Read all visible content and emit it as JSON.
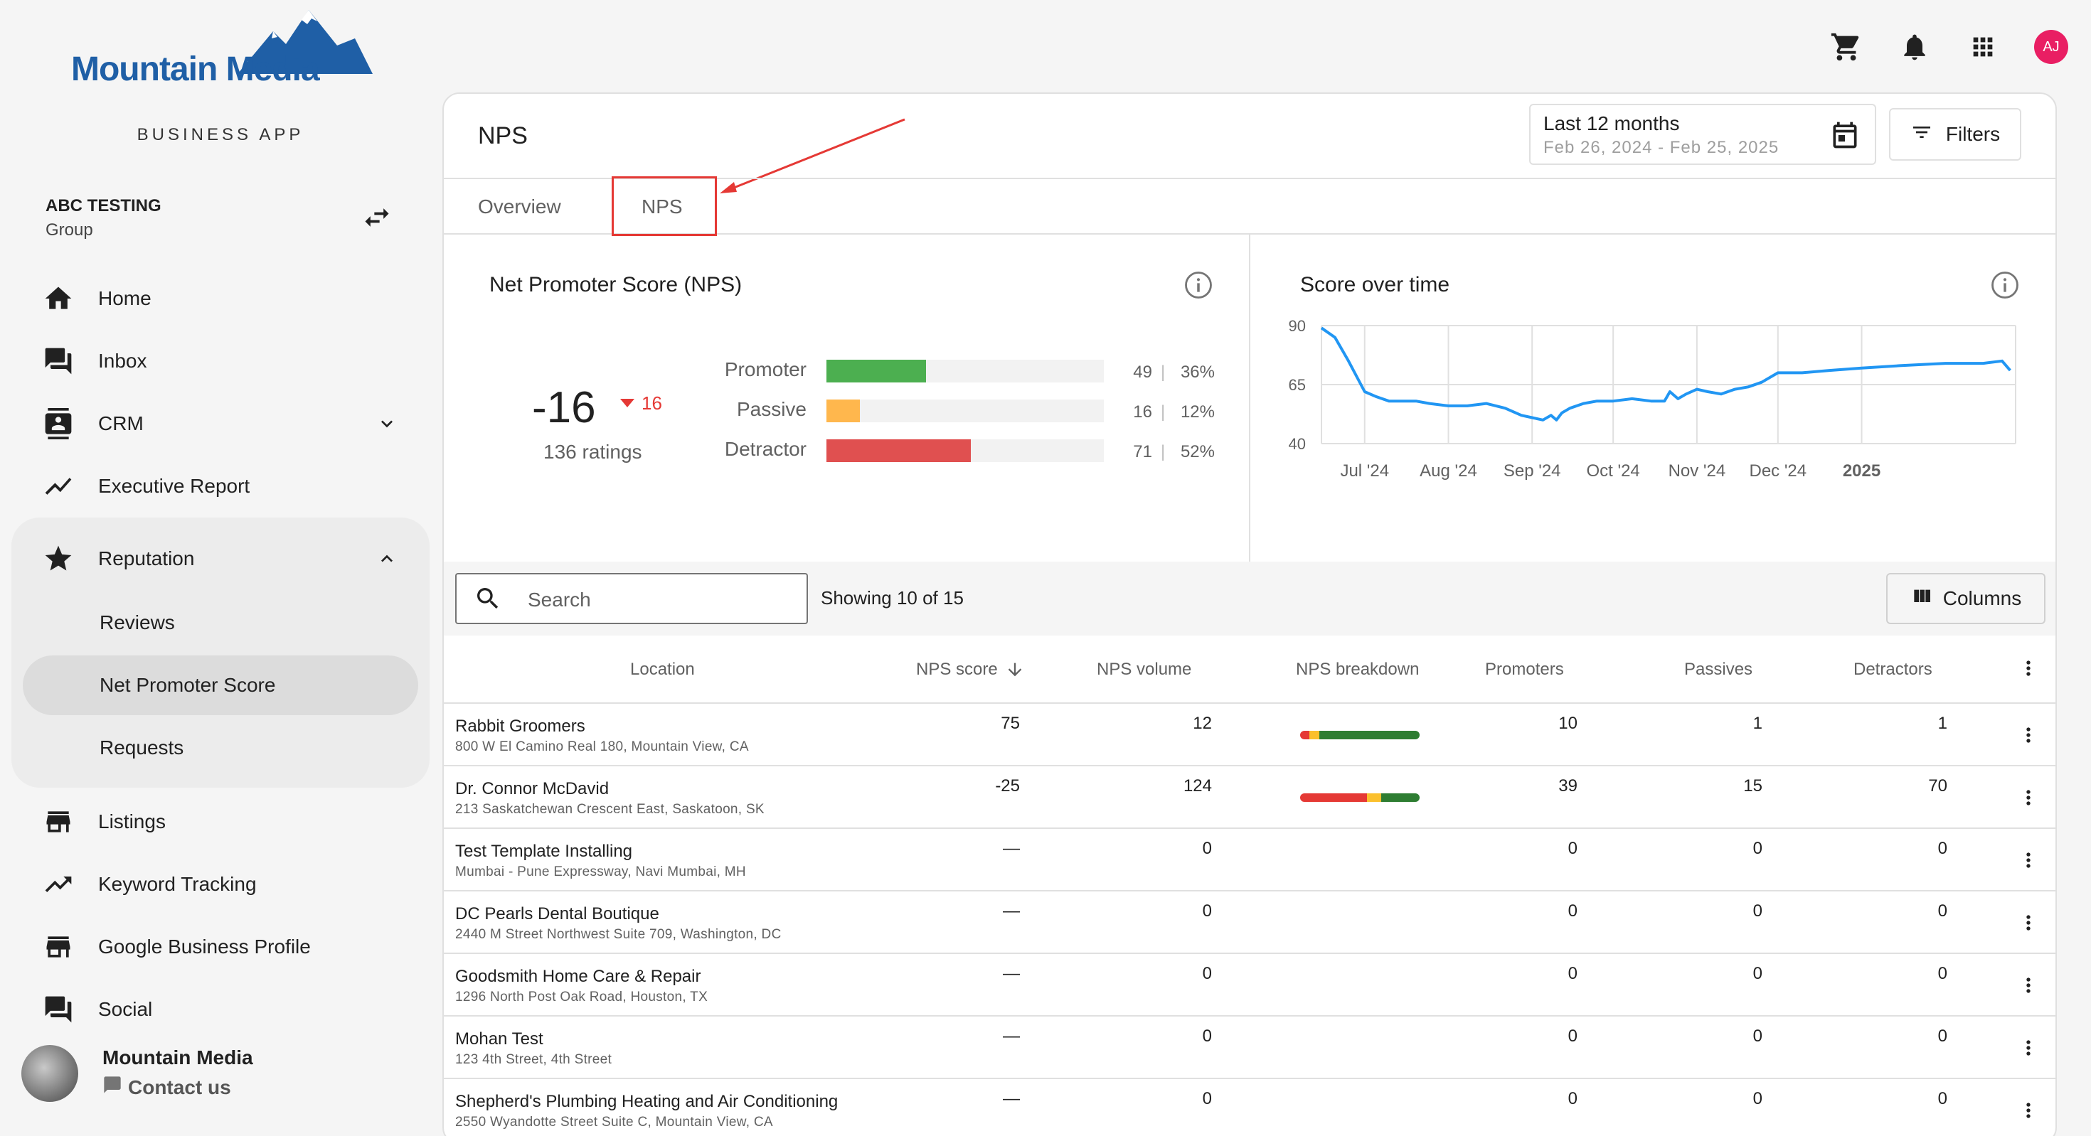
{
  "brand": {
    "logo_text": "Mountain Media",
    "subtitle": "BUSINESS APP",
    "color": "#1f5fa6"
  },
  "account": {
    "name": "ABC TESTING",
    "type": "Group"
  },
  "nav": {
    "home": "Home",
    "inbox": "Inbox",
    "crm": "CRM",
    "executive_report": "Executive Report",
    "reputation": "Reputation",
    "reviews": "Reviews",
    "net_promoter_score": "Net Promoter Score",
    "requests": "Requests",
    "listings": "Listings",
    "keyword_tracking": "Keyword Tracking",
    "google_business_profile": "Google Business Profile",
    "social": "Social"
  },
  "footer": {
    "name": "Mountain Media",
    "contact": "Contact us"
  },
  "topbar": {
    "user_initials": "AJ",
    "avatar_color": "#e91e63"
  },
  "page": {
    "title": "NPS",
    "date_range": {
      "label": "Last 12 months",
      "range": "Feb 26, 2024 - Feb 25, 2025"
    },
    "filters_label": "Filters",
    "tabs": [
      "Overview",
      "NPS"
    ],
    "active_tab": "NPS"
  },
  "nps_panel": {
    "title": "Net Promoter Score (NPS)",
    "score": "-16",
    "delta": "16",
    "ratings": "136 ratings",
    "rows": [
      {
        "label": "Promoter",
        "count": "49",
        "pct": "36%",
        "fraction": 0.36,
        "color": "#4caf50"
      },
      {
        "label": "Passive",
        "count": "16",
        "pct": "12%",
        "fraction": 0.12,
        "color": "#ffb74d"
      },
      {
        "label": "Detractor",
        "count": "71",
        "pct": "52%",
        "fraction": 0.52,
        "color": "#e05050"
      }
    ]
  },
  "chart_data": {
    "type": "line",
    "title": "Score over time",
    "x_ticks": [
      "Jul '24",
      "Aug '24",
      "Sep '24",
      "Oct '24",
      "Nov '24",
      "Dec '24",
      "2025"
    ],
    "y_ticks": [
      40,
      65,
      90
    ],
    "ylim": [
      40,
      90
    ],
    "grid": true,
    "color": "#2196f3",
    "series": [
      {
        "x": [
          "2024-06-15",
          "2024-06-20",
          "2024-06-25",
          "2024-07-01",
          "2024-07-05",
          "2024-07-10",
          "2024-07-15",
          "2024-07-20",
          "2024-07-25",
          "2024-08-01",
          "2024-08-08",
          "2024-08-15",
          "2024-08-22",
          "2024-08-28",
          "2024-09-01",
          "2024-09-05",
          "2024-09-08",
          "2024-09-10",
          "2024-09-12",
          "2024-09-15",
          "2024-09-20",
          "2024-09-25",
          "2024-10-01",
          "2024-10-08",
          "2024-10-15",
          "2024-10-20",
          "2024-10-22",
          "2024-10-25",
          "2024-10-28",
          "2024-11-01",
          "2024-11-05",
          "2024-11-10",
          "2024-11-15",
          "2024-11-20",
          "2024-11-25",
          "2024-12-01",
          "2024-12-10",
          "2024-12-20",
          "2025-01-01",
          "2025-01-15",
          "2025-02-01",
          "2025-02-15",
          "2025-02-22",
          "2025-02-25"
        ],
        "values": [
          89,
          85,
          75,
          62,
          60,
          58,
          58,
          58,
          57,
          56,
          56,
          57,
          55,
          52,
          51,
          50,
          52,
          50,
          53,
          55,
          57,
          58,
          58,
          59,
          58,
          58,
          62,
          59,
          61,
          63,
          62,
          61,
          63,
          64,
          66,
          70,
          70,
          71,
          72,
          73,
          74,
          74,
          75,
          71
        ]
      }
    ]
  },
  "table": {
    "search_placeholder": "Search",
    "showing": "Showing 10 of 15",
    "columns_label": "Columns",
    "headers": [
      "Location",
      "NPS score",
      "NPS volume",
      "NPS breakdown",
      "Promoters",
      "Passives",
      "Detractors"
    ],
    "rows": [
      {
        "name": "Rabbit Groomers",
        "address": "800 W El Camino Real 180, Mountain View, CA",
        "score": "75",
        "volume": "12",
        "promoters": "10",
        "passives": "1",
        "detractors": "1",
        "breakdown": [
          0.08,
          0.08,
          0.84
        ]
      },
      {
        "name": "Dr. Connor McDavid",
        "address": "213 Saskatchewan Crescent East, Saskatoon, SK",
        "score": "-25",
        "volume": "124",
        "promoters": "39",
        "passives": "15",
        "detractors": "70",
        "breakdown": [
          0.56,
          0.12,
          0.32
        ]
      },
      {
        "name": "Test Template Installing",
        "address": "Mumbai - Pune Expressway, Navi Mumbai, MH",
        "score": "—",
        "volume": "0",
        "promoters": "0",
        "passives": "0",
        "detractors": "0",
        "breakdown": null
      },
      {
        "name": "DC Pearls Dental Boutique",
        "address": "2440 M Street Northwest Suite 709, Washington, DC",
        "score": "—",
        "volume": "0",
        "promoters": "0",
        "passives": "0",
        "detractors": "0",
        "breakdown": null
      },
      {
        "name": "Goodsmith Home Care & Repair",
        "address": "1296 North Post Oak Road, Houston, TX",
        "score": "—",
        "volume": "0",
        "promoters": "0",
        "passives": "0",
        "detractors": "0",
        "breakdown": null
      },
      {
        "name": "Mohan Test",
        "address": "123 4th Street, 4th Street",
        "score": "—",
        "volume": "0",
        "promoters": "0",
        "passives": "0",
        "detractors": "0",
        "breakdown": null
      },
      {
        "name": "Shepherd's Plumbing Heating and Air Conditioning",
        "address": "2550 Wyandotte Street Suite C, Mountain View, CA",
        "score": "—",
        "volume": "0",
        "promoters": "0",
        "passives": "0",
        "detractors": "0",
        "breakdown": null
      }
    ]
  }
}
